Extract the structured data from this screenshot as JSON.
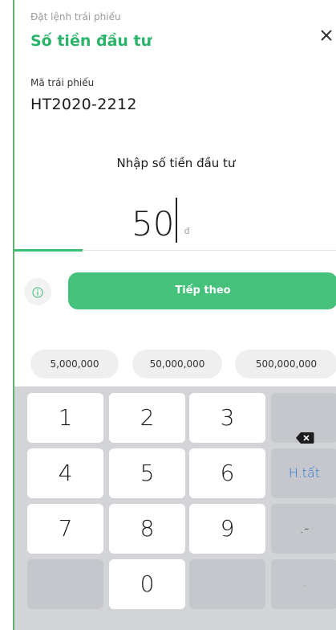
{
  "header": {
    "breadcrumb": "Đặt lệnh trái phiếu",
    "title": "Số tiền đầu tư",
    "close_icon": "close-icon"
  },
  "bond": {
    "label": "Mã trái phiếu",
    "code": "HT2020-2212"
  },
  "amount_input": {
    "prompt": "Nhập số tiền đầu tư",
    "value": "50",
    "currency": "đ"
  },
  "progress": {
    "fraction": 0.21,
    "color": "#3cbf76"
  },
  "actions": {
    "info_icon": "info-icon",
    "next_label": "Tiếp theo"
  },
  "quick_amounts": [
    "5,000,000",
    "50,000,000",
    "500,000,000"
  ],
  "keypad": {
    "keys": [
      [
        "1",
        "2",
        "3",
        "⌫"
      ],
      [
        "4",
        "5",
        "6",
        "H.tất"
      ],
      [
        "7",
        "8",
        "9",
        ".-"
      ],
      [
        "",
        "0",
        "",
        ","
      ]
    ],
    "backspace_icon": "backspace-icon",
    "done_label": "H.tất"
  },
  "colors": {
    "accent": "#2bb36a",
    "button": "#45c17b",
    "done_text": "#2a7bd6"
  }
}
